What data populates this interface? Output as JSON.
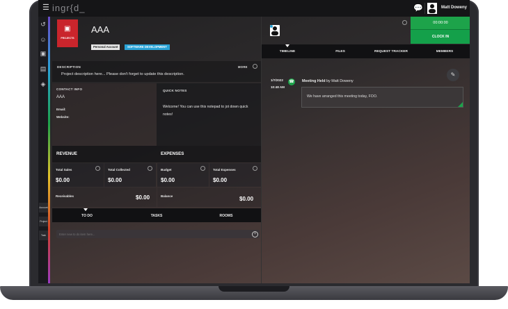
{
  "app": {
    "logo": "ingr{d_",
    "user_name": "Matt Doweny"
  },
  "sidebar": {
    "buttons": [
      "Account",
      "Project",
      "Task"
    ]
  },
  "project": {
    "badge_label": "PROJECTS",
    "title": "AAA",
    "tags": [
      "Personal Account",
      "SOFTWARE DEVELOPMENT"
    ],
    "description_label": "DESCRIPTION",
    "description_more": "MORE",
    "description_text": "Project description here... Please don't forget to update this description.",
    "contact": {
      "label": "CONTACT INFO",
      "name": "AAA",
      "email_label": "Email:",
      "website_label": "Website:"
    },
    "notes": {
      "label": "QUICK NOTES",
      "text": "Welcome! You can use this notepad to jot down quick notes!"
    },
    "revenue": {
      "label": "REVENUE",
      "total_sales_label": "Total Sales",
      "total_sales": "$0.00",
      "total_collected_label": "Total Collected",
      "total_collected": "$0.00",
      "receivables_label": "Receivables",
      "receivables": "$0.00"
    },
    "expenses": {
      "label": "EXPENSES",
      "budget_label": "Budget",
      "budget": "$0.00",
      "total_expenses_label": "Total Expenses",
      "total_expenses": "$0.00",
      "balance_label": "Balance",
      "balance": "$0.00"
    },
    "bottom_tabs": [
      "TO DO",
      "TASKS",
      "ROOMS"
    ],
    "todo_placeholder": "Enter new to do item here..."
  },
  "right": {
    "clock_time": "00:00:00",
    "clock_button": "CLOCK IN",
    "tabs": [
      "TIMELINE",
      "FILES",
      "REQUEST TRACKER",
      "MEMBERS"
    ],
    "timeline": {
      "date": "1/7/2022",
      "time": "10:48 AM",
      "event_title": "Meeting Held",
      "event_by": "by Matt Doweny",
      "event_text": "We have arranged this meeting today, FOO."
    }
  },
  "colors": {
    "accent_green": "#1da34a",
    "badge_red": "#c9252c",
    "tag_blue": "#2aa3d6"
  }
}
